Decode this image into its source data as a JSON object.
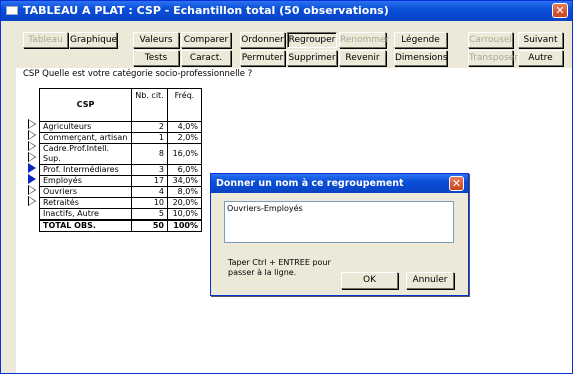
{
  "window": {
    "title": "TABLEAU A PLAT : CSP - Echantillon total (50 observations)",
    "close_label": "✕"
  },
  "toolbar": {
    "row1": [
      "Tableau",
      "Graphique",
      "Valeurs",
      "Comparer",
      "Ordonner",
      "Regrouper",
      "Renommer",
      "Légende",
      "Carrousel",
      "Suivant"
    ],
    "row2": [
      "Tests",
      "Caract.",
      "Permuter",
      "Supprimer",
      "Revenir",
      "Dimensions",
      "Transposer",
      "Autre"
    ]
  },
  "question": "CSP  Quelle est votre catégorie socio-professionnelle ?",
  "table": {
    "headers": [
      "CSP",
      "Nb. cit.",
      "Fréq."
    ],
    "rows": [
      {
        "label": "Agriculteurs",
        "count": "2",
        "freq": "4,0%"
      },
      {
        "label": "Commerçant, artisan",
        "count": "1",
        "freq": "2,0%"
      },
      {
        "label": "Cadre.Prof.Intell. Sup.",
        "count": "8",
        "freq": "16,0%"
      },
      {
        "label": "Prof. Intermédiares",
        "count": "3",
        "freq": "6,0%"
      },
      {
        "label": "Employés",
        "count": "17",
        "freq": "34,0%"
      },
      {
        "label": "Ouvriers",
        "count": "4",
        "freq": "8,0%"
      },
      {
        "label": "Retraités",
        "count": "10",
        "freq": "20,0%"
      },
      {
        "label": "Inactifs, Autre",
        "count": "5",
        "freq": "10,0%"
      }
    ],
    "total": {
      "label": "TOTAL OBS.",
      "count": "50",
      "freq": "100%"
    }
  },
  "dialog": {
    "title": "Donner un nom à ce regroupement",
    "input_value": "Ouvriers-Employés",
    "hint": "Taper Ctrl + ENTREE pour passer à la ligne.",
    "ok": "OK",
    "cancel": "Annuler",
    "close_label": "✕"
  }
}
